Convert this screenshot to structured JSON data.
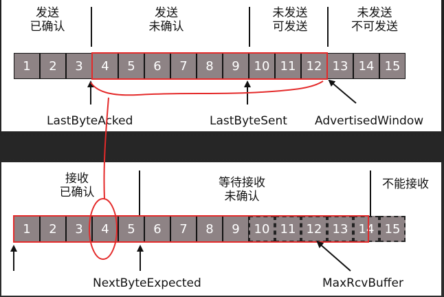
{
  "top": {
    "headers": [
      "发送\n已确认",
      "发送\n未确认",
      "未发送\n可发送",
      "未发送\n不可发送"
    ],
    "cells": [
      "1",
      "2",
      "3",
      "4",
      "5",
      "6",
      "7",
      "8",
      "9",
      "10",
      "11",
      "12",
      "13",
      "14",
      "15"
    ],
    "labels": {
      "last_byte_acked": "LastByteAcked",
      "last_byte_sent": "LastByteSent",
      "advertised_window": "AdvertisedWindow"
    }
  },
  "bottom": {
    "headers": [
      "接收\n已确认",
      "等待接收\n未确认",
      "不能接收"
    ],
    "cells": [
      "1",
      "2",
      "3",
      "4",
      "5",
      "6",
      "7",
      "8",
      "9",
      "10",
      "11",
      "12",
      "13",
      "14",
      "15"
    ],
    "labels": {
      "next_byte_expected": "NextByteExpected",
      "max_rcv_buffer": "MaxRcvBuffer"
    }
  },
  "colors": {
    "cell_fill": "#8e8385",
    "red_annotation": "#e42a2a",
    "text": "#111111"
  }
}
